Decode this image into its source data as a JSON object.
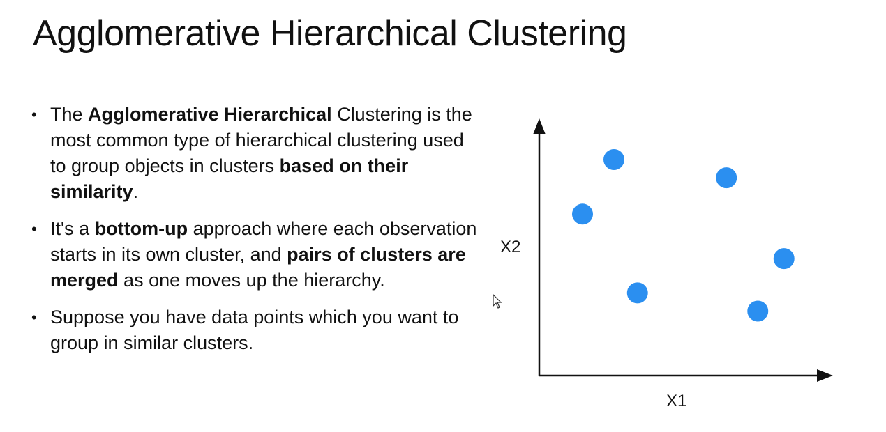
{
  "slide": {
    "title": "Agglomerative Hierarchical Clustering",
    "bullets": [
      {
        "segments": [
          {
            "text": "The ",
            "bold": false
          },
          {
            "text": "Agglomerative Hierarchical",
            "bold": true
          },
          {
            "text": " Clustering is the most common type of hierarchical clustering used to group objects in clusters ",
            "bold": false
          },
          {
            "text": "based on their similarity",
            "bold": true
          },
          {
            "text": ".",
            "bold": false
          }
        ]
      },
      {
        "segments": [
          {
            "text": "It's a ",
            "bold": false
          },
          {
            "text": "bottom-up",
            "bold": true
          },
          {
            "text": " approach where each observation starts in its own cluster, and ",
            "bold": false
          },
          {
            "text": "pairs of clusters are merged",
            "bold": true
          },
          {
            "text": " as one moves up the hierarchy.",
            "bold": false
          }
        ]
      },
      {
        "segments": [
          {
            "text": "Suppose you have data points which you want to group in similar clusters.",
            "bold": false
          }
        ]
      }
    ]
  },
  "chart_data": {
    "type": "scatter",
    "xlabel": "X1",
    "ylabel": "X2",
    "xlim": [
      0,
      100
    ],
    "ylim": [
      0,
      100
    ],
    "point_color": "#2b8ff0",
    "points": [
      {
        "x": 24,
        "y": 90
      },
      {
        "x": 12,
        "y": 63
      },
      {
        "x": 67,
        "y": 81
      },
      {
        "x": 89,
        "y": 41
      },
      {
        "x": 33,
        "y": 24
      },
      {
        "x": 79,
        "y": 15
      }
    ]
  }
}
